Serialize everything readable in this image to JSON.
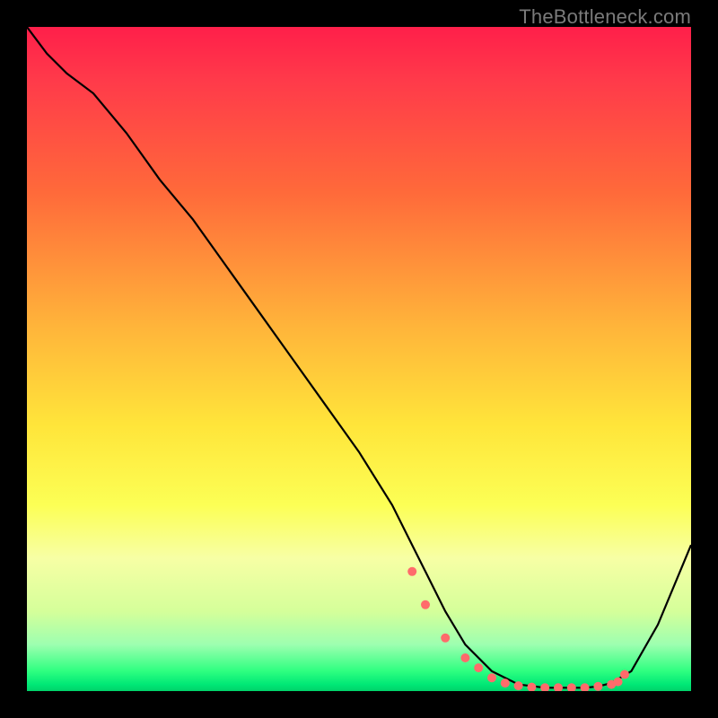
{
  "watermark": "TheBottleneck.com",
  "chart_data": {
    "type": "line",
    "title": "",
    "xlabel": "",
    "ylabel": "",
    "xlim": [
      0,
      100
    ],
    "ylim": [
      0,
      100
    ],
    "grid": false,
    "legend": false,
    "series": [
      {
        "name": "bottleneck-curve",
        "x": [
          0,
          3,
          6,
          10,
          15,
          20,
          25,
          30,
          35,
          40,
          45,
          50,
          55,
          58,
          60,
          63,
          66,
          70,
          74,
          78,
          80,
          82,
          84,
          86,
          88,
          91,
          95,
          100
        ],
        "values": [
          100,
          96,
          93,
          90,
          84,
          77,
          71,
          64,
          57,
          50,
          43,
          36,
          28,
          22,
          18,
          12,
          7,
          3,
          1,
          0.5,
          0.5,
          0.5,
          0.5,
          0.7,
          1.2,
          3,
          10,
          22
        ]
      }
    ],
    "markers": {
      "name": "highlight-points",
      "x": [
        58,
        60,
        63,
        66,
        68,
        70,
        72,
        74,
        76,
        78,
        80,
        82,
        84,
        86,
        88,
        89,
        90
      ],
      "values": [
        18,
        13,
        8,
        5,
        3.5,
        2,
        1.2,
        0.8,
        0.6,
        0.5,
        0.5,
        0.5,
        0.5,
        0.7,
        1.0,
        1.4,
        2.5
      ]
    },
    "background": {
      "type": "vertical-gradient",
      "stops": [
        {
          "pos": 0.0,
          "color": "#ff1f4a"
        },
        {
          "pos": 0.25,
          "color": "#ff6a3a"
        },
        {
          "pos": 0.5,
          "color": "#ffd23a"
        },
        {
          "pos": 0.72,
          "color": "#fcff55"
        },
        {
          "pos": 0.9,
          "color": "#c8ff9a"
        },
        {
          "pos": 1.0,
          "color": "#00d26a"
        }
      ]
    }
  }
}
